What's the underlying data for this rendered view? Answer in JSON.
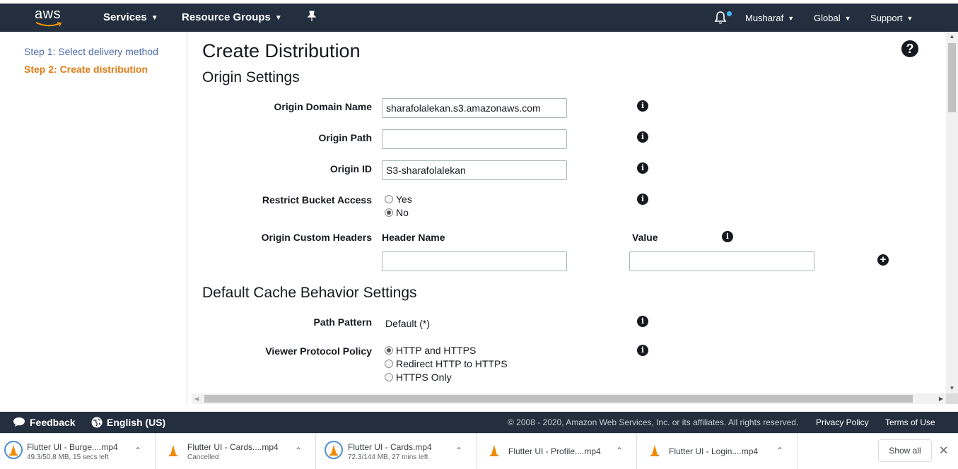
{
  "topnav": {
    "logo": "aws",
    "services": "Services",
    "resource_groups": "Resource Groups",
    "user": "Musharaf",
    "region": "Global",
    "support": "Support"
  },
  "sidebar": {
    "steps": [
      {
        "label": "Step 1: Select delivery method"
      },
      {
        "label": "Step 2: Create distribution"
      }
    ]
  },
  "main": {
    "title": "Create Distribution",
    "help_glyph": "?",
    "origin_settings": {
      "heading": "Origin Settings",
      "origin_domain_name": {
        "label": "Origin Domain Name",
        "value": "sharafolalekan.s3.amazonaws.com"
      },
      "origin_path": {
        "label": "Origin Path",
        "value": ""
      },
      "origin_id": {
        "label": "Origin ID",
        "value": "S3-sharafolalekan"
      },
      "restrict_bucket_access": {
        "label": "Restrict Bucket Access",
        "options": [
          "Yes",
          "No"
        ],
        "selected": "No"
      },
      "origin_custom_headers": {
        "label": "Origin Custom Headers",
        "header_name_col": "Header Name",
        "value_col": "Value",
        "header_name_value": "",
        "value_value": ""
      }
    },
    "cache_behavior": {
      "heading": "Default Cache Behavior Settings",
      "path_pattern": {
        "label": "Path Pattern",
        "value": "Default (*)"
      },
      "viewer_protocol_policy": {
        "label": "Viewer Protocol Policy",
        "options": [
          "HTTP and HTTPS",
          "Redirect HTTP to HTTPS",
          "HTTPS Only"
        ],
        "selected": "HTTP and HTTPS"
      }
    },
    "info_glyph": "i",
    "plus_glyph": "+"
  },
  "footer": {
    "feedback": "Feedback",
    "language": "English (US)",
    "copyright": "© 2008 - 2020, Amazon Web Services, Inc. or its affiliates. All rights reserved.",
    "privacy": "Privacy Policy",
    "terms": "Terms of Use"
  },
  "downloads": {
    "items": [
      {
        "name": "Flutter UI - Burge....mp4",
        "status": "49.3/50.8 MB, 15 secs left"
      },
      {
        "name": "Flutter UI - Cards....mp4",
        "status": "Cancelled"
      },
      {
        "name": "Flutter UI - Cards.mp4",
        "status": "72.3/144 MB, 27 mins left"
      },
      {
        "name": "Flutter UI - Profile....mp4",
        "status": ""
      },
      {
        "name": "Flutter UI - Login....mp4",
        "status": ""
      }
    ],
    "show_all": "Show all"
  },
  "colors": {
    "nav_bg": "#232f3e",
    "step_active": "#e07b14",
    "step_link": "#4e6aa8",
    "notification_dot": "#44b9f5"
  }
}
